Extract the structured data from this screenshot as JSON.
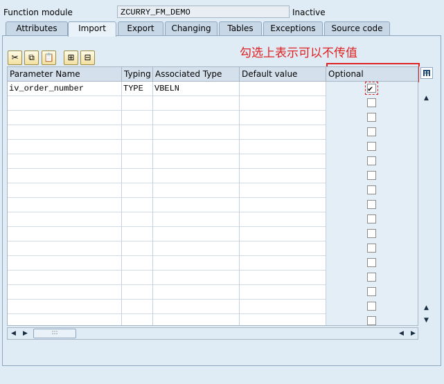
{
  "header": {
    "label": "Function module",
    "name": "ZCURRY_FM_DEMO",
    "status": "Inactive"
  },
  "tabs": [
    {
      "label": "Attributes"
    },
    {
      "label": "Import",
      "active": true
    },
    {
      "label": "Export"
    },
    {
      "label": "Changing"
    },
    {
      "label": "Tables"
    },
    {
      "label": "Exceptions"
    },
    {
      "label": "Source code"
    }
  ],
  "toolbar": {
    "icons": [
      "cut-icon",
      "copy-icon",
      "paste-icon",
      "insert-row-icon",
      "delete-row-icon"
    ]
  },
  "annotation": "勾选上表示可以不传值",
  "table": {
    "columns": [
      "Parameter Name",
      "Typing",
      "Associated Type",
      "Default value",
      "Optional"
    ],
    "rows": [
      {
        "name": "iv_order_number",
        "typing": "TYPE",
        "assoc": "VBELN",
        "default": "",
        "optional": true
      }
    ],
    "empty_rows": 16
  },
  "colors": {
    "accent_red": "#e02020",
    "panel_bg": "#dfebf5"
  }
}
